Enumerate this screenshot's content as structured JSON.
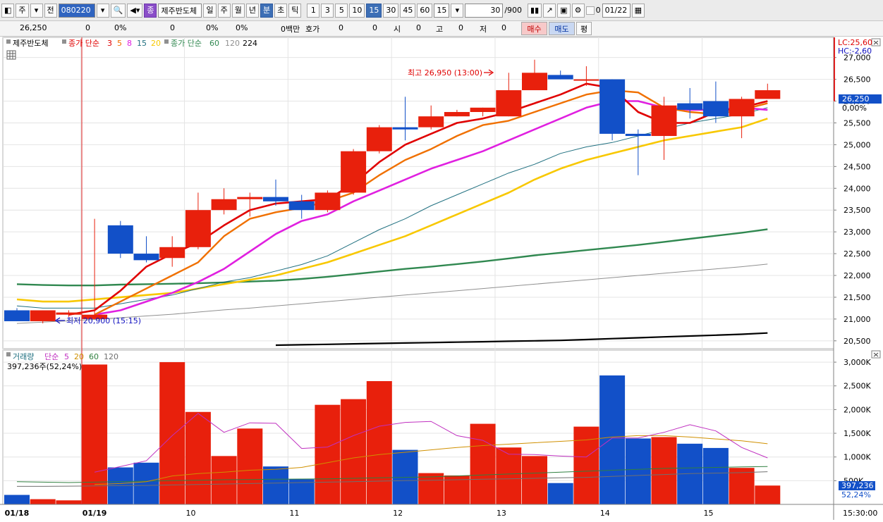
{
  "toolbar": {
    "tab_stock": "주",
    "tab_prev": "전",
    "code": "080220",
    "name_badge": "종",
    "stock_name": "제주반도체",
    "periods": [
      "일",
      "주",
      "월",
      "년",
      "분",
      "초",
      "틱"
    ],
    "active_period": "분",
    "intervals": [
      "1",
      "3",
      "5",
      "10",
      "15",
      "30",
      "45",
      "60"
    ],
    "active_interval": "15",
    "interval_select": "15",
    "count": "30",
    "count_total": "/900",
    "date_check": "0",
    "date": "01/22"
  },
  "quote": {
    "price": "26,250",
    "change": "0",
    "change_pct": "0%",
    "volume": "0",
    "vol_pct": "0%",
    "val_pct": "0%",
    "amount_label": "0백만",
    "hoga_label": "호가",
    "hoga_val": "0",
    "v2": "0",
    "open_label": "시",
    "open_val": "0",
    "high_label": "고",
    "high_val": "0",
    "low_label": "저",
    "low_val": "0",
    "buy": "매수",
    "sell": "매도",
    "eval": "평"
  },
  "legend": {
    "name": "제주반도체",
    "ma_label": "종가 단순",
    "ma_periods": [
      "3",
      "5",
      "8",
      "15",
      "20"
    ],
    "ma2_label": "종가 단순",
    "ma2_periods": [
      "60",
      "120",
      "224"
    ],
    "vol_label": "거래량",
    "vol_ma_label": "단순",
    "vol_ma_periods": [
      "5",
      "20",
      "60",
      "120"
    ],
    "vol_current": "397,236주(52,24%)"
  },
  "annotations": {
    "high": "최고 26,950 (13:00)",
    "low": "최저 20,900 (15:15)"
  },
  "right_labels": {
    "lc": "LC:25,60",
    "hc": "HC:-2,60",
    "price_badge": "26,250",
    "pct_badge": "0,00%",
    "vol_badge": "397,236",
    "vol_pct_badge": "52,24%",
    "time": "15:30:00"
  },
  "colors": {
    "up": "#e8200c",
    "down": "#1250c8",
    "ma3": "#e00000",
    "ma5": "#f07000",
    "ma8": "#e020e0",
    "ma15": "#207080",
    "ma20": "#f8c800",
    "ma60": "#308850",
    "ma120": "#909090",
    "ma224": "#000000",
    "vma5": "#c030c0",
    "vma20": "#d09000",
    "vma60": "#308040",
    "vma120": "#707070"
  },
  "chart_data": {
    "type": "candlestick",
    "title": "제주반도체",
    "y_ticks": [
      "27,000",
      "26,500",
      "26,000",
      "25,500",
      "25,000",
      "24,500",
      "24,000",
      "23,500",
      "23,000",
      "22,500",
      "22,000",
      "21,500",
      "21,000",
      "20,500"
    ],
    "ylim": [
      20400,
      27350
    ],
    "vol_ticks": [
      "3,000K",
      "2,500K",
      "2,000K",
      "1,500K",
      "1,000K",
      "500K"
    ],
    "vol_lim": [
      0,
      3150000
    ],
    "x_ticks": [
      {
        "label": "01/18",
        "bar": 0,
        "bold": true
      },
      {
        "label": "01/19",
        "bar": 3,
        "bold": true
      },
      {
        "label": "10",
        "bar": 7,
        "bold": false
      },
      {
        "label": "11",
        "bar": 11,
        "bold": false
      },
      {
        "label": "12",
        "bar": 15,
        "bold": false
      },
      {
        "label": "13",
        "bar": 19,
        "bold": false
      },
      {
        "label": "14",
        "bar": 23,
        "bold": false
      },
      {
        "label": "15",
        "bar": 27,
        "bold": false
      }
    ],
    "candles": [
      {
        "o": 21200,
        "h": 21250,
        "c": 20950,
        "l": 20950
      },
      {
        "o": 20950,
        "h": 21200,
        "c": 21200,
        "l": 20900
      },
      {
        "o": 21100,
        "h": 21200,
        "c": 21150,
        "l": 21050
      },
      {
        "o": 21000,
        "h": 23300,
        "c": 21100,
        "l": 21000
      },
      {
        "o": 23150,
        "h": 23250,
        "c": 22500,
        "l": 22400
      },
      {
        "o": 22500,
        "h": 22900,
        "c": 22350,
        "l": 22300
      },
      {
        "o": 22400,
        "h": 22900,
        "c": 22650,
        "l": 22200
      },
      {
        "o": 22650,
        "h": 23900,
        "c": 23500,
        "l": 22600
      },
      {
        "o": 23500,
        "h": 24000,
        "c": 23750,
        "l": 23400
      },
      {
        "o": 23750,
        "h": 23900,
        "c": 23800,
        "l": 23350
      },
      {
        "o": 23800,
        "h": 24200,
        "c": 23700,
        "l": 23600
      },
      {
        "o": 23700,
        "h": 23850,
        "c": 23500,
        "l": 23300
      },
      {
        "o": 23500,
        "h": 23950,
        "c": 23900,
        "l": 23450
      },
      {
        "o": 23900,
        "h": 24900,
        "c": 24850,
        "l": 23850
      },
      {
        "o": 24850,
        "h": 25450,
        "c": 25400,
        "l": 24800
      },
      {
        "o": 25400,
        "h": 26100,
        "c": 25350,
        "l": 25100
      },
      {
        "o": 25400,
        "h": 25900,
        "c": 25650,
        "l": 25350
      },
      {
        "o": 25650,
        "h": 25800,
        "c": 25750,
        "l": 25650
      },
      {
        "o": 25750,
        "h": 25850,
        "c": 25850,
        "l": 25650
      },
      {
        "o": 25650,
        "h": 26650,
        "c": 26250,
        "l": 25650
      },
      {
        "o": 26250,
        "h": 26950,
        "c": 26650,
        "l": 26250
      },
      {
        "o": 26600,
        "h": 26700,
        "c": 26500,
        "l": 26500
      },
      {
        "o": 26500,
        "h": 26800,
        "c": 26500,
        "l": 26350
      },
      {
        "o": 26500,
        "h": 26500,
        "c": 25250,
        "l": 25100
      },
      {
        "o": 25250,
        "h": 25350,
        "c": 25200,
        "l": 24300
      },
      {
        "o": 25200,
        "h": 26100,
        "c": 25900,
        "l": 24650
      },
      {
        "o": 25950,
        "h": 26300,
        "c": 25800,
        "l": 25600
      },
      {
        "o": 26000,
        "h": 26450,
        "c": 25650,
        "l": 25500
      },
      {
        "o": 25650,
        "h": 26100,
        "c": 26050,
        "l": 25150
      },
      {
        "o": 26050,
        "h": 26400,
        "c": 26250,
        "l": 26150
      }
    ],
    "volume": [
      200000,
      110000,
      85000,
      2950000,
      780000,
      880000,
      3000000,
      1950000,
      1020000,
      1600000,
      800000,
      530000,
      2100000,
      2220000,
      2600000,
      1150000,
      660000,
      610000,
      1700000,
      1200000,
      1020000,
      450000,
      1640000,
      2720000,
      1390000,
      1420000,
      1280000,
      1190000,
      770000,
      397236
    ],
    "ma": {
      "ma3": [
        null,
        null,
        21100,
        21200,
        21650,
        22200,
        22500,
        22750,
        23150,
        23500,
        23650,
        23700,
        23750,
        24100,
        24600,
        25000,
        25250,
        25500,
        25600,
        25750,
        25950,
        26150,
        26400,
        26300,
        25750,
        25500,
        25500,
        25750,
        25850,
        26000
      ],
      "ma5": [
        null,
        null,
        null,
        21100,
        21400,
        21700,
        22000,
        22300,
        22900,
        23300,
        23450,
        23550,
        23700,
        23900,
        24300,
        24650,
        24900,
        25200,
        25450,
        25550,
        25750,
        25950,
        26150,
        26250,
        26200,
        25850,
        25750,
        25700,
        25800,
        25950
      ],
      "ma8": [
        null,
        null,
        null,
        21100,
        21200,
        21400,
        21600,
        21850,
        22150,
        22550,
        22950,
        23250,
        23400,
        23700,
        23950,
        24200,
        24450,
        24650,
        24850,
        25100,
        25350,
        25600,
        25850,
        26000,
        26000,
        25850,
        25800,
        25800,
        25850,
        25800
      ],
      "ma15": [
        21300,
        21250,
        21250,
        21250,
        21350,
        21450,
        21550,
        21700,
        21850,
        21950,
        22100,
        22250,
        22450,
        22750,
        23050,
        23300,
        23600,
        23850,
        24100,
        24350,
        24550,
        24800,
        24950,
        25050,
        25200,
        25350,
        25500,
        25600,
        25700,
        25850
      ],
      "ma20": [
        21450,
        21400,
        21400,
        21450,
        21500,
        21550,
        21600,
        21700,
        21800,
        21900,
        22000,
        22150,
        22300,
        22500,
        22700,
        22900,
        23150,
        23400,
        23650,
        23900,
        24200,
        24450,
        24650,
        24800,
        24950,
        25100,
        25200,
        25300,
        25400,
        25600
      ],
      "ma60": [
        21800,
        21780,
        21770,
        21770,
        21790,
        21800,
        21810,
        21820,
        21840,
        21860,
        21880,
        21920,
        21970,
        22030,
        22090,
        22150,
        22200,
        22260,
        22320,
        22390,
        22460,
        22520,
        22580,
        22640,
        22700,
        22770,
        22840,
        22910,
        22980,
        23060
      ],
      "ma120": [
        20900,
        20930,
        20960,
        20990,
        21030,
        21070,
        21110,
        21160,
        21210,
        21250,
        21300,
        21350,
        21400,
        21450,
        21500,
        21550,
        21600,
        21650,
        21700,
        21750,
        21800,
        21850,
        21900,
        21950,
        22000,
        22050,
        22100,
        22150,
        22200,
        22260
      ],
      "ma224": [
        null,
        null,
        null,
        null,
        null,
        null,
        null,
        null,
        null,
        null,
        20400,
        20410,
        20420,
        20430,
        20440,
        20450,
        20460,
        20470,
        20480,
        20490,
        20500,
        20510,
        20530,
        20550,
        20570,
        20590,
        20610,
        20630,
        20650,
        20680
      ]
    },
    "vol_ma": {
      "vma5": [
        null,
        null,
        null,
        680000,
        800000,
        920000,
        1450000,
        1920000,
        1520000,
        1720000,
        1710000,
        1180000,
        1210000,
        1450000,
        1650000,
        1730000,
        1750000,
        1450000,
        1350000,
        1060000,
        1050000,
        1020000,
        1000000,
        1400000,
        1400000,
        1520000,
        1680000,
        1550000,
        1200000,
        980000
      ],
      "vma20": [
        null,
        null,
        null,
        420000,
        440000,
        480000,
        600000,
        650000,
        680000,
        720000,
        740000,
        780000,
        880000,
        980000,
        1050000,
        1100000,
        1150000,
        1200000,
        1240000,
        1270000,
        1300000,
        1330000,
        1360000,
        1420000,
        1450000,
        1450000,
        1420000,
        1380000,
        1340000,
        1280000
      ],
      "vma60": [
        480000,
        470000,
        460000,
        470000,
        480000,
        490000,
        500000,
        510000,
        520000,
        525000,
        530000,
        535000,
        540000,
        550000,
        560000,
        570000,
        580000,
        600000,
        620000,
        640000,
        660000,
        680000,
        700000,
        720000,
        740000,
        760000,
        770000,
        780000,
        790000,
        800000
      ],
      "vma120": [
        380000,
        380000,
        385000,
        390000,
        395000,
        400000,
        410000,
        420000,
        430000,
        440000,
        450000,
        460000,
        470000,
        480000,
        490000,
        500000,
        510000,
        520000,
        530000,
        540000,
        550000,
        560000,
        570000,
        590000,
        610000,
        630000,
        650000,
        660000,
        670000,
        690000
      ]
    }
  }
}
